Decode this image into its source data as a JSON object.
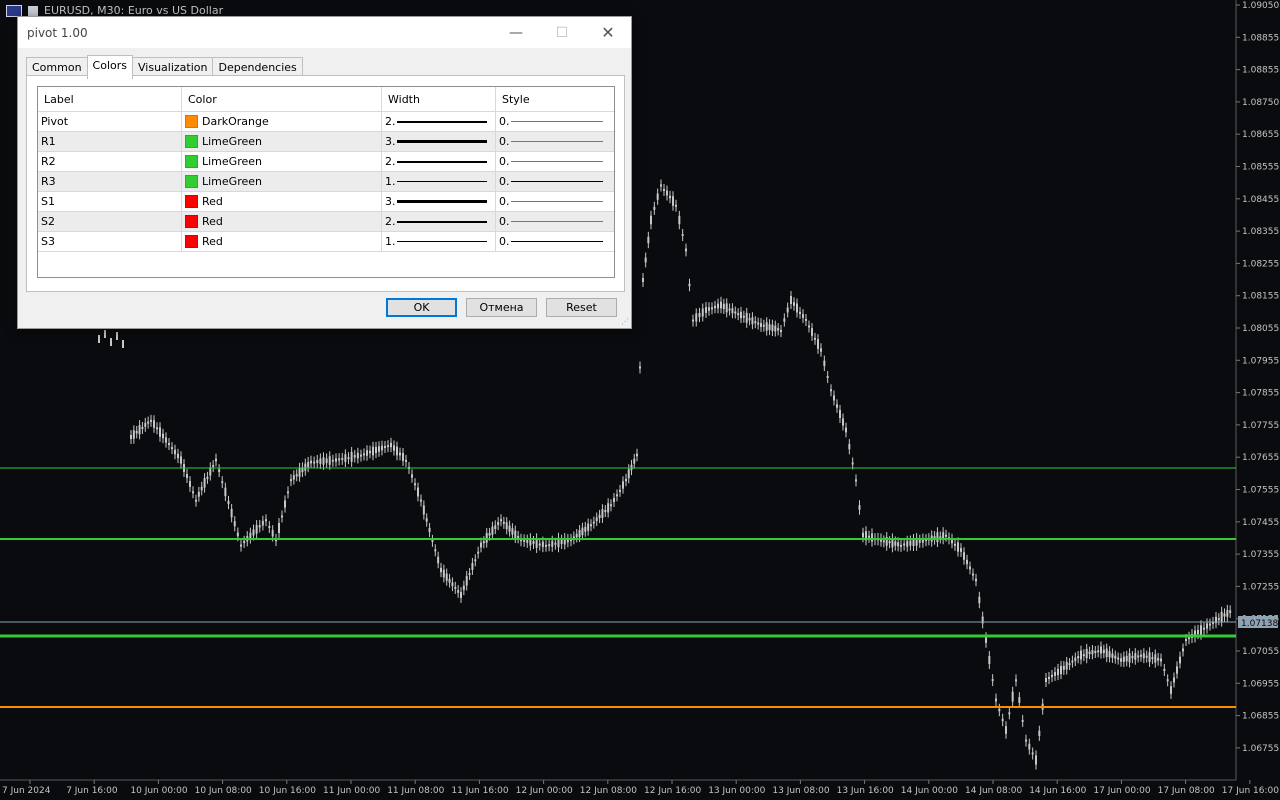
{
  "chart": {
    "title": "EURUSD, M30:  Euro vs US Dollar",
    "current_price": "1.07138",
    "price_labels": [
      "1.09050",
      "1.08855",
      "1.08855",
      "1.08750",
      "1.08655",
      "1.08555",
      "1.08455",
      "1.08355",
      "1.08255",
      "1.08155",
      "1.08055",
      "1.07955",
      "1.07855",
      "1.07755",
      "1.07655",
      "1.07555",
      "1.07455",
      "1.07355",
      "1.07255",
      "1.07155",
      "1.07055",
      "1.06955",
      "1.06855",
      "1.06755"
    ],
    "time_labels": [
      "7 Jun 2024",
      "7 Jun 16:00",
      "10 Jun 00:00",
      "10 Jun 08:00",
      "10 Jun 16:00",
      "11 Jun 00:00",
      "11 Jun 08:00",
      "11 Jun 16:00",
      "12 Jun 00:00",
      "12 Jun 08:00",
      "12 Jun 16:00",
      "13 Jun 00:00",
      "13 Jun 08:00",
      "13 Jun 16:00",
      "14 Jun 00:00",
      "14 Jun 08:00",
      "14 Jun 16:00",
      "17 Jun 00:00",
      "17 Jun 08:00",
      "17 Jun 16:00"
    ],
    "colors": {
      "background": "#0a0b0e",
      "candles": "#c8c8c8",
      "pivot": "#ff8c00",
      "support_resistance": "#32cd32",
      "current": "#8fa3b3"
    }
  },
  "dialog": {
    "title": "pivot 1.00",
    "tabs": [
      {
        "label": "Common"
      },
      {
        "label": "Colors"
      },
      {
        "label": "Visualization"
      },
      {
        "label": "Dependencies"
      }
    ],
    "active_tab": "Colors",
    "columns": [
      "Label",
      "Color",
      "Width",
      "Style"
    ],
    "rows": [
      {
        "label": "Pivot",
        "color_name": "DarkOrange",
        "color": "#ff8c00",
        "width": "2.",
        "style": "0."
      },
      {
        "label": "R1",
        "color_name": "LimeGreen",
        "color": "#32cd32",
        "width": "3.",
        "style": "0."
      },
      {
        "label": "R2",
        "color_name": "LimeGreen",
        "color": "#32cd32",
        "width": "2.",
        "style": "0."
      },
      {
        "label": "R3",
        "color_name": "LimeGreen",
        "color": "#32cd32",
        "width": "1.",
        "style": "0."
      },
      {
        "label": "S1",
        "color_name": "Red",
        "color": "#ff0000",
        "width": "3.",
        "style": "0."
      },
      {
        "label": "S2",
        "color_name": "Red",
        "color": "#ff0000",
        "width": "2.",
        "style": "0."
      },
      {
        "label": "S3",
        "color_name": "Red",
        "color": "#ff0000",
        "width": "1.",
        "style": "0."
      }
    ],
    "buttons": {
      "ok": "OK",
      "cancel": "Отмена",
      "reset": "Reset"
    }
  }
}
